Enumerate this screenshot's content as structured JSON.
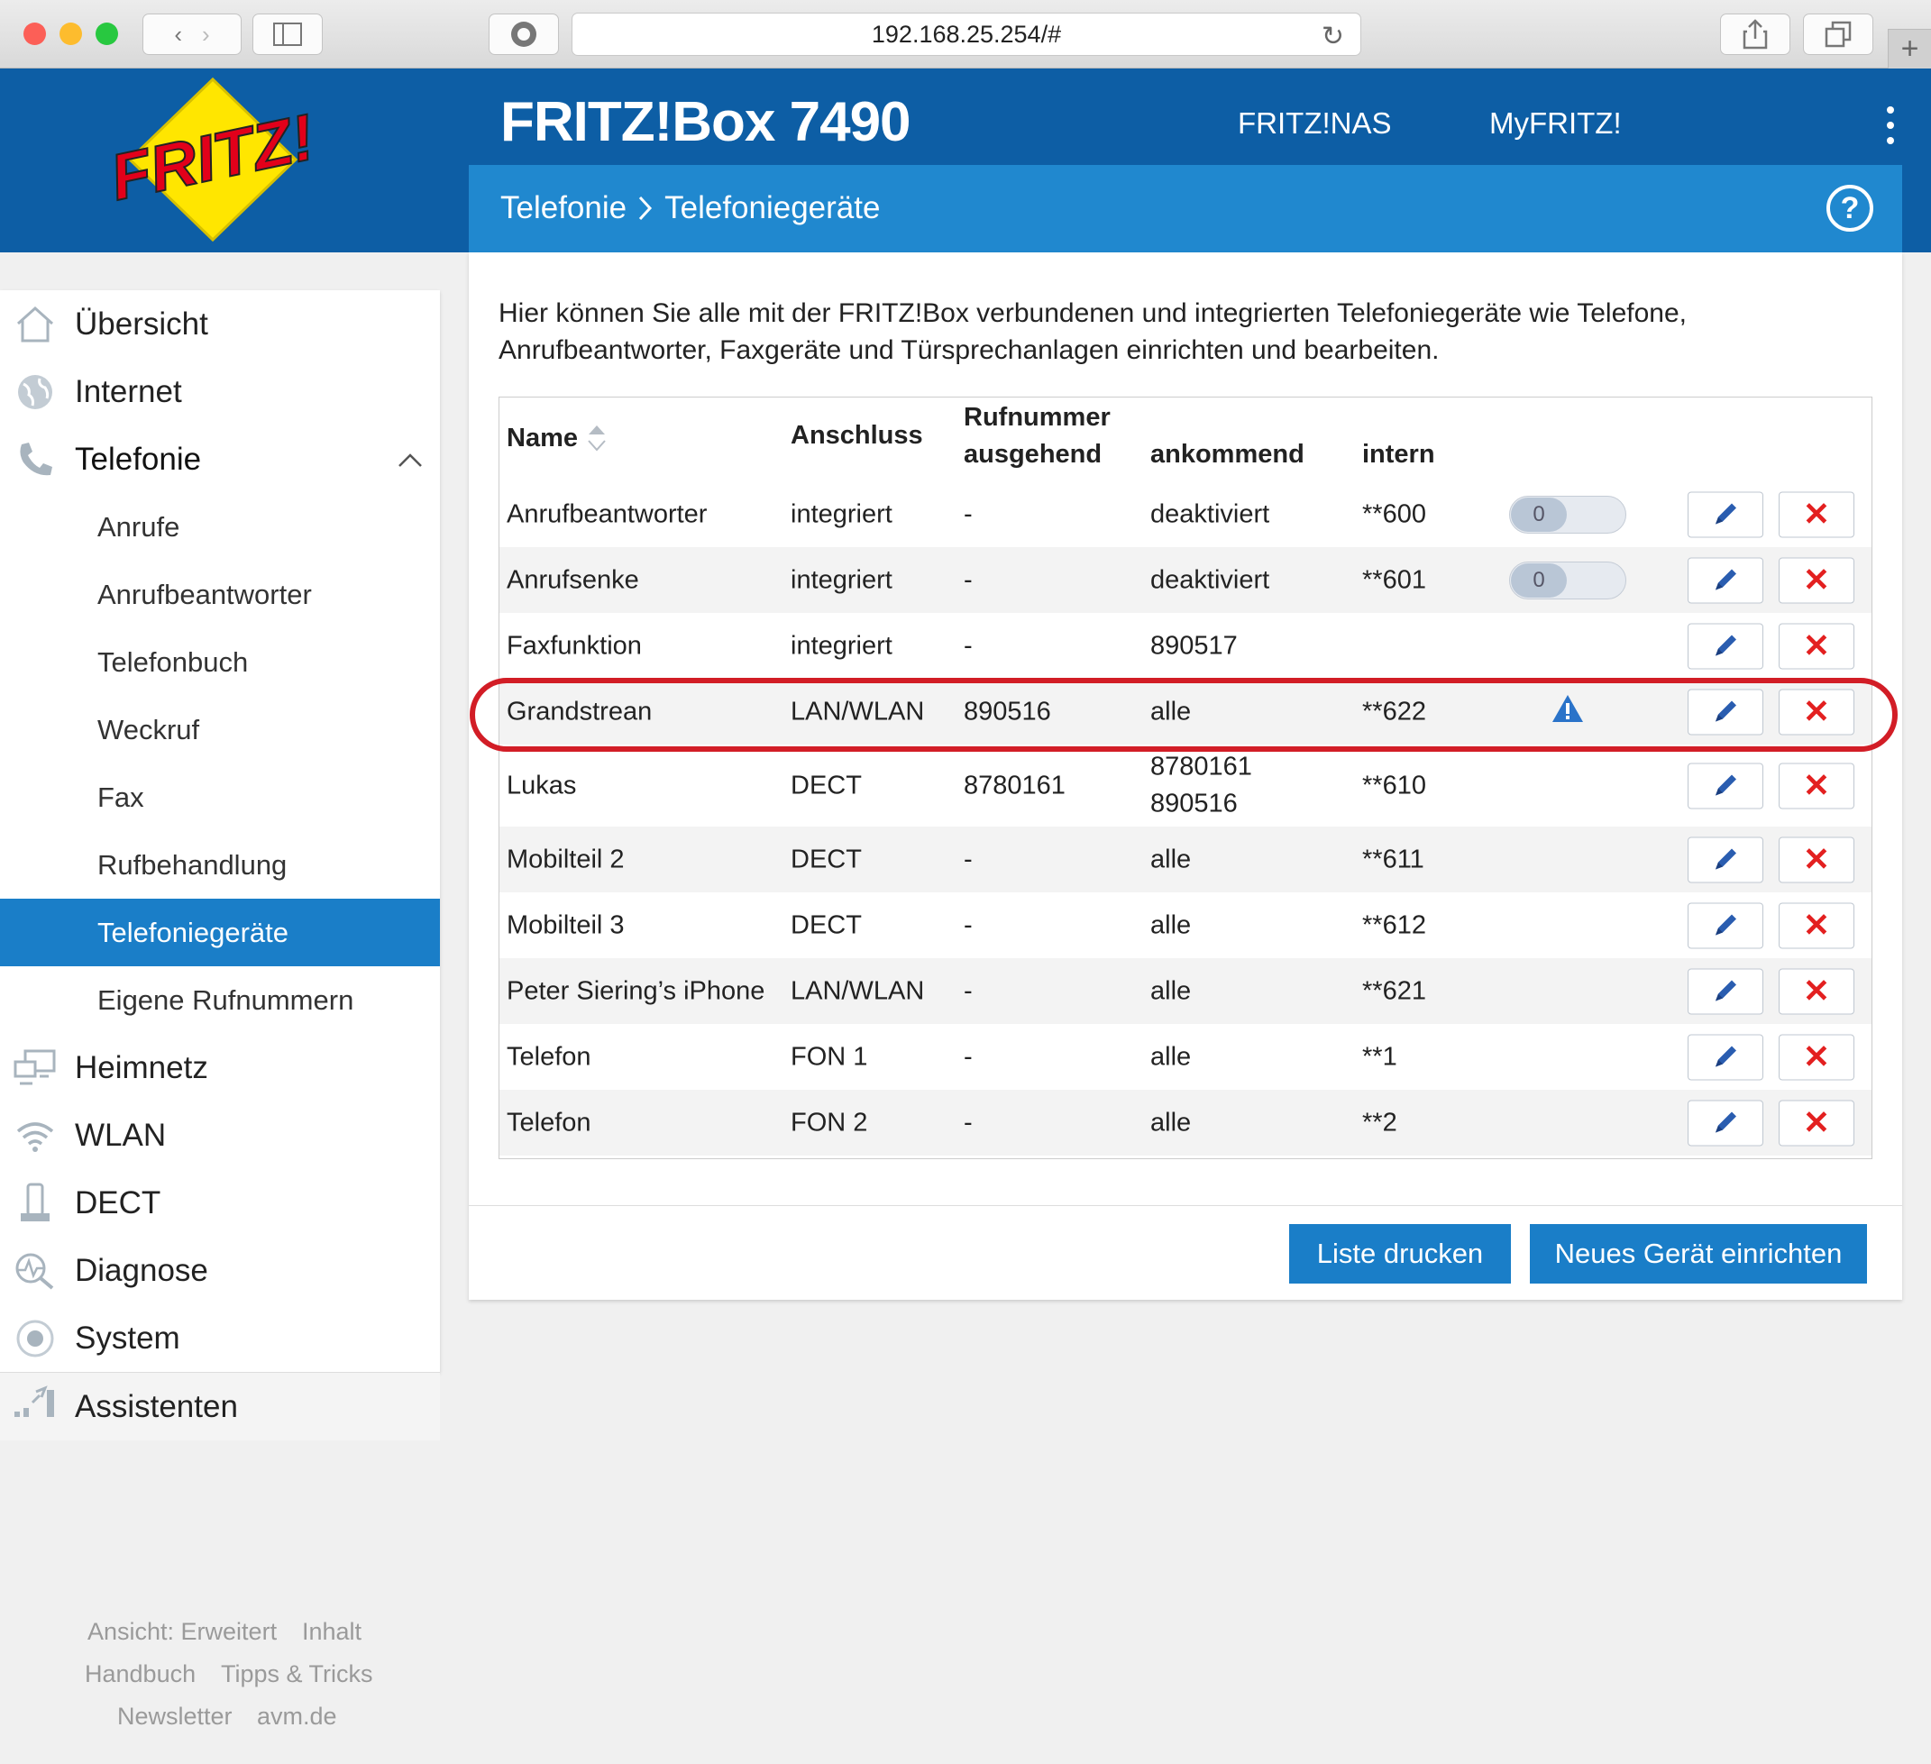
{
  "browser": {
    "url": "192.168.25.254/#"
  },
  "header": {
    "brand": "FRITZ!Box 7490",
    "links": [
      "FRITZ!NAS",
      "MyFRITZ!"
    ],
    "logo_text": "FRITZ!"
  },
  "breadcrumb": {
    "section": "Telefonie",
    "page": "Telefoniegeräte",
    "help": "?"
  },
  "sidebar": {
    "items": [
      {
        "label": "Übersicht",
        "icon": "home-icon"
      },
      {
        "label": "Internet",
        "icon": "globe-icon"
      },
      {
        "label": "Telefonie",
        "icon": "phone-icon"
      }
    ],
    "sub": [
      "Anrufe",
      "Anrufbeantworter",
      "Telefonbuch",
      "Weckruf",
      "Fax",
      "Rufbehandlung",
      "Telefoniegeräte",
      "Eigene Rufnummern"
    ],
    "items2": [
      {
        "label": "Heimnetz",
        "icon": "network-icon"
      },
      {
        "label": "WLAN",
        "icon": "wifi-icon"
      },
      {
        "label": "DECT",
        "icon": "dect-phone-icon"
      },
      {
        "label": "Diagnose",
        "icon": "diagnose-icon"
      },
      {
        "label": "System",
        "icon": "system-icon"
      }
    ],
    "assist": "Assistenten"
  },
  "intro": "Hier können Sie alle mit der FRITZ!Box verbundenen und integrierten Telefoniegeräte wie Telefone, Anrufbeantworter, Faxgeräte und Türsprechanlagen einrichten und bearbeiten.",
  "table": {
    "headers": {
      "name": "Name",
      "anschluss": "Anschluss",
      "rufnummer": "Rufnummer",
      "ausgehend": "ausgehend",
      "ankommend": "ankommend",
      "intern": "intern"
    },
    "rows": [
      {
        "name": "Anrufbeantworter",
        "anschluss": "integriert",
        "ausgehend": "-",
        "ankommend": "deaktiviert",
        "ankommend2": "",
        "intern": "**600",
        "toggle": "0"
      },
      {
        "name": "Anrufsenke",
        "anschluss": "integriert",
        "ausgehend": "-",
        "ankommend": "deaktiviert",
        "ankommend2": "",
        "intern": "**601",
        "toggle": "0"
      },
      {
        "name": "Faxfunktion",
        "anschluss": "integriert",
        "ausgehend": "-",
        "ankommend": "890517",
        "ankommend2": "",
        "intern": ""
      },
      {
        "name": "Grandstrean",
        "anschluss": "LAN/WLAN",
        "ausgehend": "890516",
        "ankommend": "alle",
        "ankommend2": "",
        "intern": "**622",
        "warning": true
      },
      {
        "name": "Lukas",
        "anschluss": "DECT",
        "ausgehend": "8780161",
        "ankommend": "8780161",
        "ankommend2": "890516",
        "intern": "**610"
      },
      {
        "name": "Mobilteil 2",
        "anschluss": "DECT",
        "ausgehend": "-",
        "ankommend": "alle",
        "ankommend2": "",
        "intern": "**611"
      },
      {
        "name": "Mobilteil 3",
        "anschluss": "DECT",
        "ausgehend": "-",
        "ankommend": "alle",
        "ankommend2": "",
        "intern": "**612"
      },
      {
        "name": "Peter Siering’s iPhone",
        "anschluss": "LAN/WLAN",
        "ausgehend": "-",
        "ankommend": "alle",
        "ankommend2": "",
        "intern": "**621"
      },
      {
        "name": "Telefon",
        "anschluss": "FON 1",
        "ausgehend": "-",
        "ankommend": "alle",
        "ankommend2": "",
        "intern": "**1"
      },
      {
        "name": "Telefon",
        "anschluss": "FON 2",
        "ausgehend": "-",
        "ankommend": "alle",
        "ankommend2": "",
        "intern": "**2"
      }
    ]
  },
  "buttons": {
    "print": "Liste drucken",
    "new": "Neues Gerät einrichten",
    "delete_glyph": "✕"
  },
  "footer": {
    "row1": [
      "Ansicht: Erweitert",
      "Inhalt"
    ],
    "row2": [
      "Handbuch",
      "Tipps & Tricks"
    ],
    "row3": [
      "Newsletter",
      "avm.de"
    ]
  },
  "colors": {
    "header": "#0d5ea5",
    "crumbbar": "#2088cf",
    "accent": "#1a7ec8",
    "highlight": "#d21d26",
    "delete": "#e32020"
  }
}
